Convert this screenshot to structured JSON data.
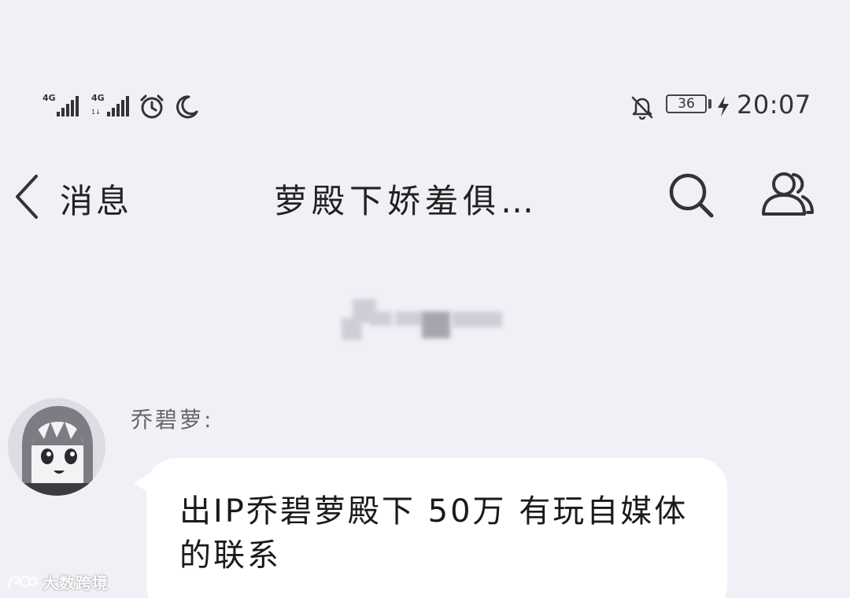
{
  "status_bar": {
    "sim1": {
      "network": "4G"
    },
    "sim2": {
      "network": "4G",
      "sub": "1↓"
    },
    "icons": [
      "signal-icon",
      "signal-icon",
      "alarm-icon",
      "moon-icon",
      "bell-muted-icon",
      "battery-icon",
      "charging-icon"
    ],
    "battery_level": "36",
    "time": "20:07"
  },
  "nav": {
    "back_label": "消息",
    "chat_title": "萝殿下娇羞俱…",
    "icons": [
      "back-chevron-icon",
      "search-icon",
      "group-members-icon"
    ]
  },
  "message": {
    "sender": "乔碧萝:",
    "text": "出IP乔碧萝殿下 50万 有玩自媒体的联系"
  },
  "watermark": {
    "text": "大数跨境"
  },
  "colors": {
    "background": "#f1f0f6",
    "bubble": "#ffffff",
    "text": "#222222"
  }
}
